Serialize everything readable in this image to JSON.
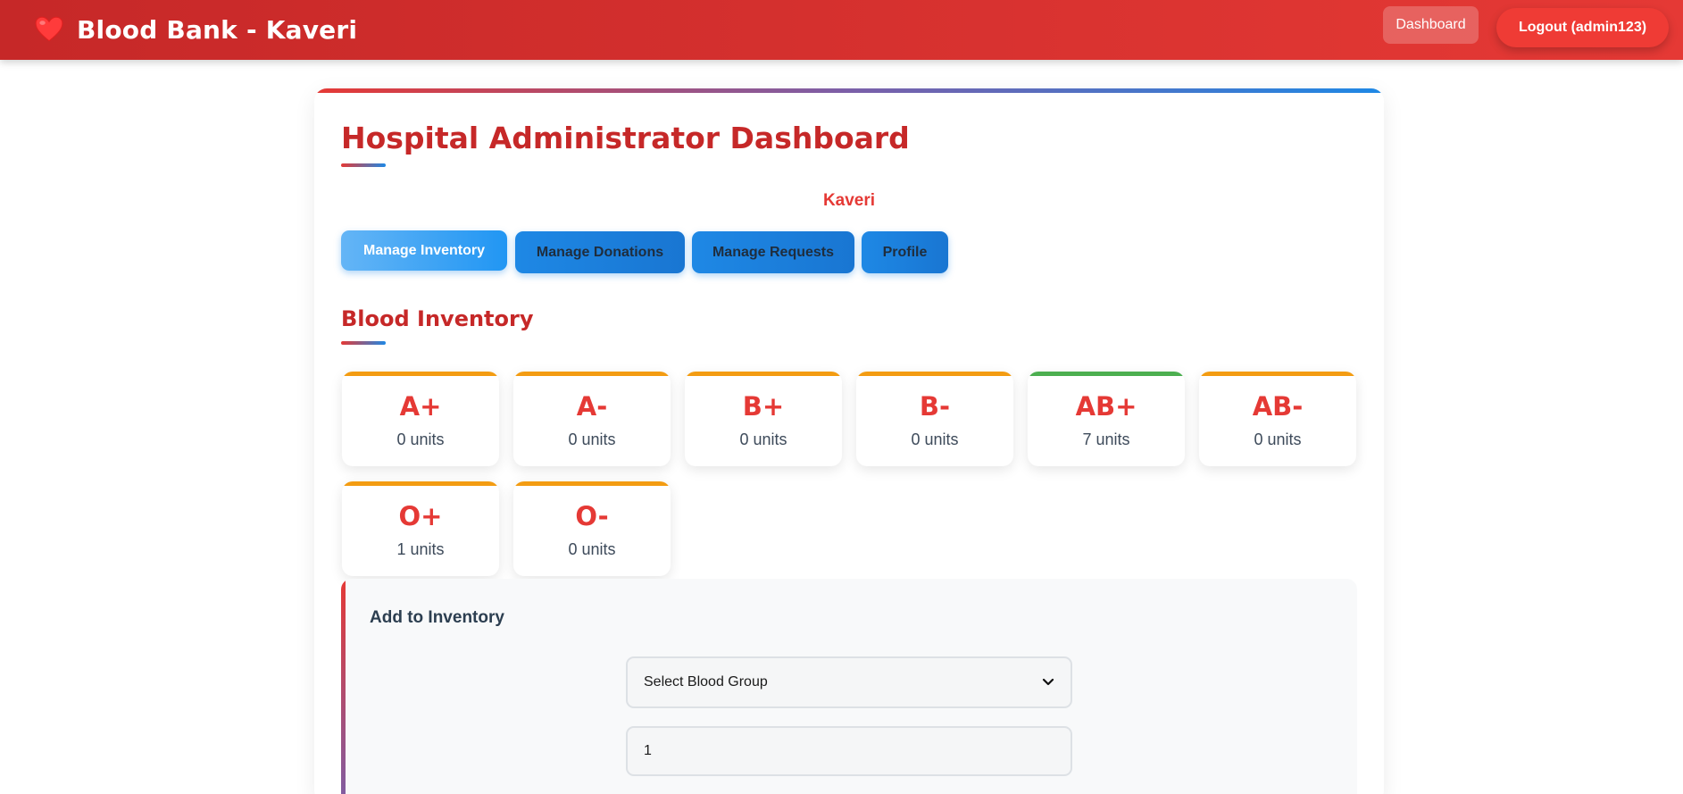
{
  "header": {
    "brand_icon": "heart-icon",
    "brand_title": "Blood Bank - Kaveri",
    "nav": {
      "dashboard_label": "Dashboard",
      "logout_label": "Logout (admin123)"
    }
  },
  "main": {
    "page_title": "Hospital Administrator Dashboard",
    "hospital_name": "Kaveri",
    "tabs": [
      {
        "label": "Manage Inventory",
        "active": true
      },
      {
        "label": "Manage Donations",
        "active": false
      },
      {
        "label": "Manage Requests",
        "active": false
      },
      {
        "label": "Profile",
        "active": false
      }
    ],
    "inventory_title": "Blood Inventory",
    "inventory": [
      {
        "group": "A+",
        "units": "0 units",
        "status_color": "#f39c12"
      },
      {
        "group": "A-",
        "units": "0 units",
        "status_color": "#f39c12"
      },
      {
        "group": "B+",
        "units": "0 units",
        "status_color": "#f39c12"
      },
      {
        "group": "B-",
        "units": "0 units",
        "status_color": "#f39c12"
      },
      {
        "group": "AB+",
        "units": "7 units",
        "status_color": "#4caf50"
      },
      {
        "group": "AB-",
        "units": "0 units",
        "status_color": "#f39c12"
      },
      {
        "group": "O+",
        "units": "1 units",
        "status_color": "#f39c12"
      },
      {
        "group": "O-",
        "units": "0 units",
        "status_color": "#f39c12"
      }
    ],
    "add_form": {
      "title": "Add to Inventory",
      "blood_group_select": "Select Blood Group",
      "units_value": "1"
    }
  },
  "colors": {
    "header_red": "#d32f2f",
    "title_red": "#c62828",
    "tab_blue": "#1e88e5",
    "warning_orange": "#f39c12",
    "ok_green": "#4caf50"
  }
}
